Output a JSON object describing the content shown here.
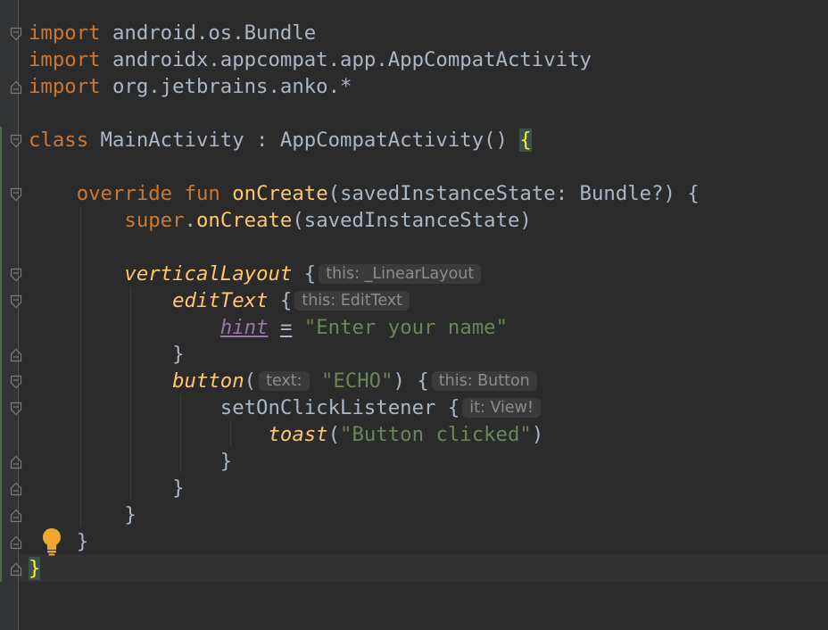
{
  "editor": {
    "colors": {
      "background": "#2b2b2b",
      "keyword": "#cc7832",
      "function": "#ffc66d",
      "string": "#6a8759",
      "property": "#9876aa",
      "text": "#a9b7c6",
      "inlay_hint": "#8c8c8c"
    },
    "lines": [
      {
        "t": [
          [
            "kw",
            "import"
          ],
          [
            "plain",
            " android.os.Bundle"
          ]
        ]
      },
      {
        "t": [
          [
            "kw",
            "import"
          ],
          [
            "plain",
            " androidx.appcompat.app.AppCompatActivity"
          ]
        ]
      },
      {
        "t": [
          [
            "kw",
            "import"
          ],
          [
            "plain",
            " org.jetbrains.anko.*"
          ]
        ]
      },
      {
        "t": []
      },
      {
        "t": [
          [
            "kw",
            "class"
          ],
          [
            "plain",
            " MainActivity : AppCompatActivity() "
          ],
          [
            "brace-hl",
            "{"
          ]
        ]
      },
      {
        "t": []
      },
      {
        "t": [
          [
            "plain",
            "    "
          ],
          [
            "kw",
            "override fun"
          ],
          [
            "plain",
            " "
          ],
          [
            "fn",
            "onCreate"
          ],
          [
            "plain",
            "(savedInstanceState: Bundle?) {"
          ]
        ]
      },
      {
        "t": [
          [
            "plain",
            "        "
          ],
          [
            "kw",
            "super"
          ],
          [
            "plain",
            "."
          ],
          [
            "fn",
            "onCreate"
          ],
          [
            "plain",
            "(savedInstanceState)"
          ]
        ]
      },
      {
        "t": []
      },
      {
        "t": [
          [
            "plain",
            "        "
          ],
          [
            "fni",
            "verticalLayout"
          ],
          [
            "plain",
            " {"
          ],
          [
            "hint",
            "this: _LinearLayout"
          ]
        ]
      },
      {
        "t": [
          [
            "plain",
            "            "
          ],
          [
            "fni",
            "editText"
          ],
          [
            "plain",
            " {"
          ],
          [
            "hint",
            "this: EditText"
          ]
        ]
      },
      {
        "t": [
          [
            "plain",
            "                "
          ],
          [
            "prop",
            "hint"
          ],
          [
            "plain",
            " "
          ],
          [
            "eq",
            "="
          ],
          [
            "plain",
            " "
          ],
          [
            "str",
            "\"Enter your name\""
          ]
        ]
      },
      {
        "t": [
          [
            "plain",
            "            }"
          ]
        ]
      },
      {
        "t": [
          [
            "plain",
            "            "
          ],
          [
            "fni",
            "button"
          ],
          [
            "plain",
            "("
          ],
          [
            "hint",
            "text:"
          ],
          [
            "str",
            " \"ECHO\""
          ],
          [
            "plain",
            ") {"
          ],
          [
            "hint",
            "this: Button"
          ]
        ]
      },
      {
        "t": [
          [
            "plain",
            "                setOnClickListener {"
          ],
          [
            "hint",
            "it: View!"
          ]
        ]
      },
      {
        "t": [
          [
            "plain",
            "                    "
          ],
          [
            "fni",
            "toast"
          ],
          [
            "plain",
            "("
          ],
          [
            "str",
            "\"Button clicked\""
          ],
          [
            "plain",
            ")"
          ]
        ]
      },
      {
        "t": [
          [
            "plain",
            "                }"
          ]
        ]
      },
      {
        "t": [
          [
            "plain",
            "            }"
          ]
        ]
      },
      {
        "t": [
          [
            "plain",
            "        }"
          ]
        ]
      },
      {
        "t": [
          [
            "plain",
            "    }"
          ]
        ]
      },
      {
        "t": [
          [
            "brace-hl",
            "}"
          ]
        ]
      }
    ],
    "icons": {
      "intention": "lightbulb-icon",
      "fold_open": "fold-open-icon",
      "fold_close": "fold-close-icon"
    }
  }
}
